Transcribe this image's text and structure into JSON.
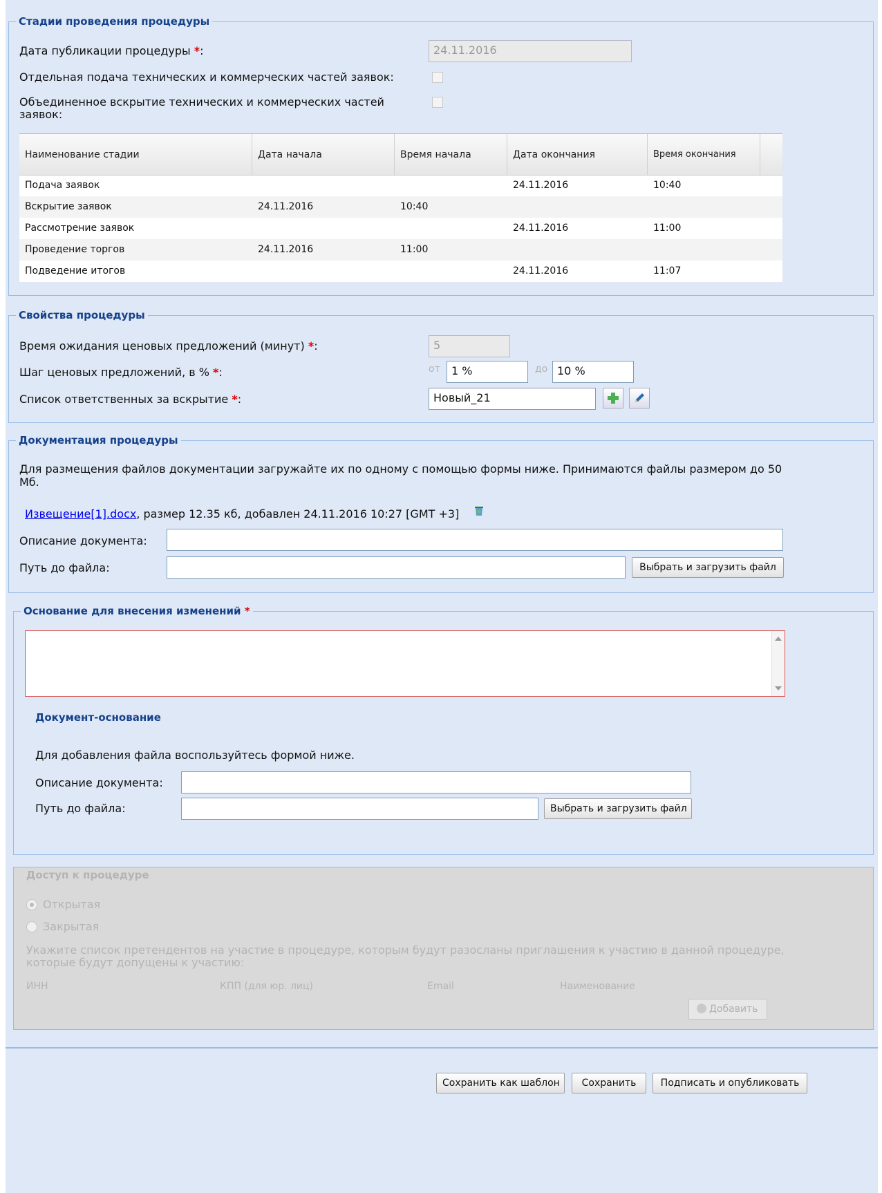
{
  "stages": {
    "legend": "Стадии проведения процедуры",
    "pub_date_label": "Дата публикации процедуры",
    "pub_date_value": "24.11.2016",
    "separate_label": "Отдельная подача технических и коммерческих частей заявок:",
    "combined_label_1": "Объединенное вскрытие технических и коммерческих частей",
    "combined_label_2": "заявок:",
    "columns": [
      "Наименование стадии",
      "Дата начала",
      "Время начала",
      "Дата окончания",
      "Время окончания"
    ],
    "rows": [
      [
        "Подача заявок",
        "",
        "",
        "24.11.2016",
        "10:40"
      ],
      [
        "Вскрытие заявок",
        "24.11.2016",
        "10:40",
        "",
        ""
      ],
      [
        "Рассмотрение заявок",
        "",
        "",
        "24.11.2016",
        "11:00"
      ],
      [
        "Проведение торгов",
        "24.11.2016",
        "11:00",
        "",
        ""
      ],
      [
        "Подведение итогов",
        "",
        "",
        "24.11.2016",
        "11:07"
      ]
    ]
  },
  "props": {
    "legend": "Свойства процедуры",
    "wait_label": "Время ожидания ценовых предложений (минут)",
    "wait_value": "5",
    "step_label": "Шаг ценовых предложений, в %",
    "from_label": "от",
    "from_value": "1 %",
    "to_label": "до",
    "to_value": "10 %",
    "resp_label": "Список ответственных за вскрытие",
    "resp_value": "Новый_21"
  },
  "docs": {
    "legend": "Документация процедуры",
    "info_1": "Для размещения файлов документации загружайте их по одному с помощью формы ниже. Принимаются файлы размером до 50",
    "info_2": "Мб.",
    "file_link": "Извещение[1].docx",
    "file_meta": ", размер 12.35 кб, добавлен 24.11.2016 10:27 [GMT +3]",
    "desc_label": "Описание документа:",
    "path_label": "Путь до файла:",
    "upload_button": "Выбрать и загрузить файл"
  },
  "basis": {
    "legend": "Основание для внесения изменений",
    "subtitle": "Документ-основание",
    "info": "Для добавления файла воспользуйтесь формой ниже.",
    "desc_label": "Описание документа:",
    "path_label": "Путь до файла:",
    "upload_button": "Выбрать и загрузить файл"
  },
  "access": {
    "legend": "Доступ к процедуре",
    "open_label": "Открытая",
    "closed_label": "Закрытая",
    "info_1": "Укажите список претендентов на участие в процедуре, которым будут разосланы приглашения к участию в данной процедуре,",
    "info_2": "которые будут допущены к участию:",
    "col_inn": "ИНН",
    "col_kpp": "КПП (для юр. лиц)",
    "col_email": "Email",
    "col_name": "Наименование",
    "add_button": "Добавить"
  },
  "footer": {
    "save_template": "Сохранить как шаблон",
    "save": "Сохранить",
    "sign_publish": "Подписать и опубликовать"
  }
}
